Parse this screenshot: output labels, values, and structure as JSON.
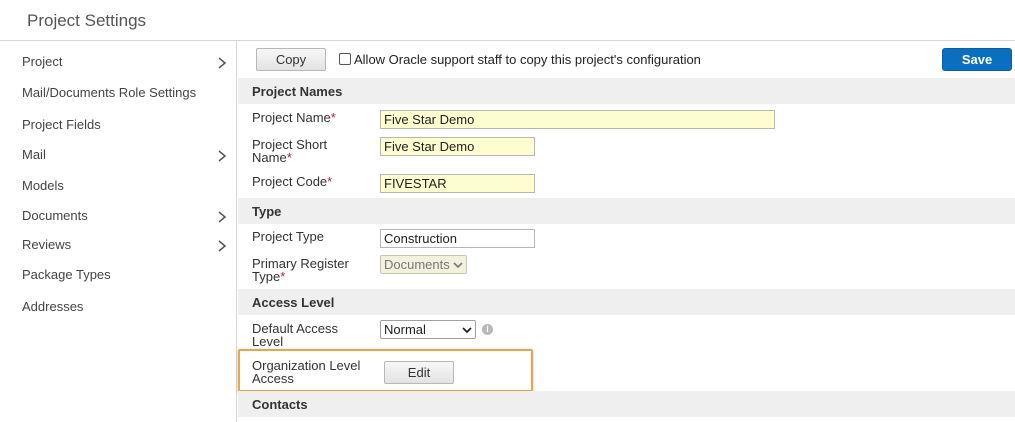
{
  "header": {
    "title": "Project Settings"
  },
  "sidebar": {
    "items": [
      {
        "label": "Project",
        "has_submenu": true
      },
      {
        "label": "Mail/Documents Role Settings",
        "has_submenu": false
      },
      {
        "label": "Project Fields",
        "has_submenu": false
      },
      {
        "label": "Mail",
        "has_submenu": true
      },
      {
        "label": "Models",
        "has_submenu": false
      },
      {
        "label": "Documents",
        "has_submenu": true
      },
      {
        "label": "Reviews",
        "has_submenu": true
      },
      {
        "label": "Package Types",
        "has_submenu": false
      },
      {
        "label": "Addresses",
        "has_submenu": false
      }
    ]
  },
  "toolbar": {
    "copy_label": "Copy",
    "allow_copy_label": "Allow Oracle support staff to copy this project's configuration",
    "allow_copy_checked": false,
    "save_label": "Save"
  },
  "sections": {
    "project_names": {
      "title": "Project Names",
      "project_name": {
        "label": "Project Name",
        "required": "*",
        "value": "Five Star Demo"
      },
      "project_short_name": {
        "label_line1": "Project Short",
        "label_line2": "Name",
        "required": "*",
        "value": "Five Star Demo"
      },
      "project_code": {
        "label": "Project Code",
        "required": "*",
        "value": "FIVESTAR"
      }
    },
    "type": {
      "title": "Type",
      "project_type": {
        "label": "Project Type",
        "value": "Construction"
      },
      "primary_register_type": {
        "label_line1": "Primary Register",
        "label_line2": "Type",
        "required": "*",
        "value": "Documents"
      }
    },
    "access_level": {
      "title": "Access Level",
      "default_access_level": {
        "label_line1": "Default Access",
        "label_line2": "Level",
        "value": "Normal",
        "info_icon": "info-icon"
      },
      "organization_level_access": {
        "label_line1": "Organization Level",
        "label_line2": "Access",
        "button_label": "Edit"
      }
    },
    "contacts": {
      "title": "Contacts"
    }
  },
  "colors": {
    "accent": "#0b6fc0",
    "required": "#c8102e",
    "highlight": "#e6a64a",
    "field_highlight": "#fdfdd0"
  }
}
